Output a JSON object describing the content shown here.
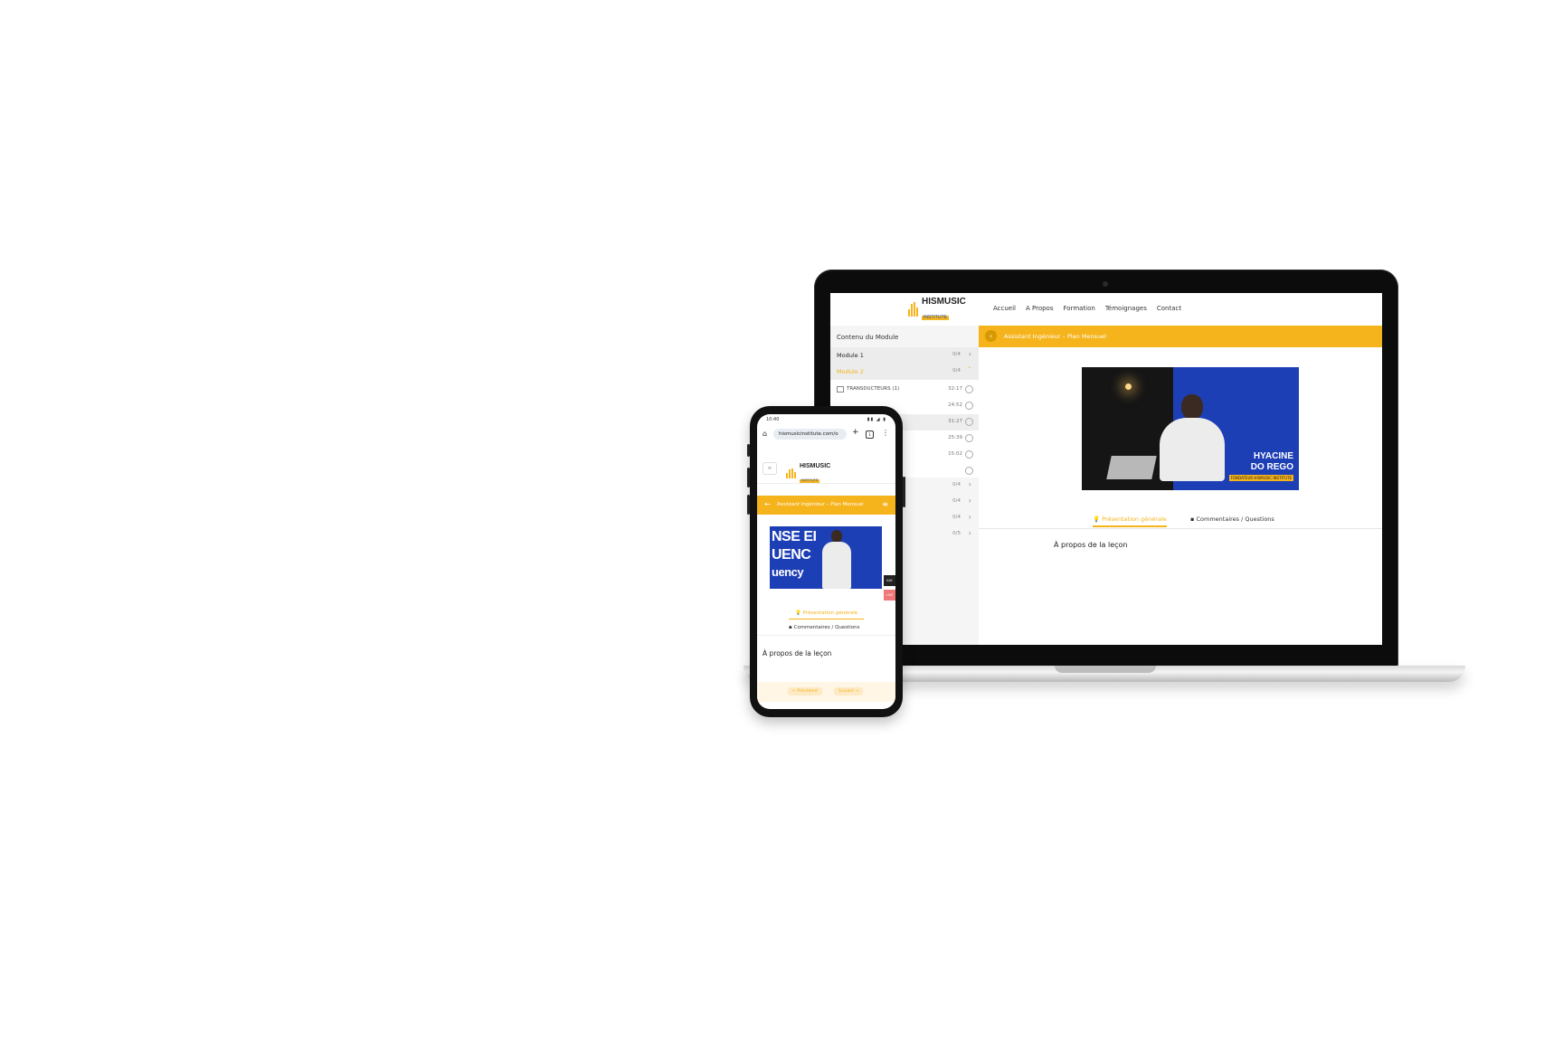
{
  "brand": {
    "name": "HISMUSIC",
    "sub": "INSTITUTE",
    "accent": "#f5b31c",
    "blue": "#1d3fb5"
  },
  "laptop": {
    "nav": [
      "Accueil",
      "A Propos",
      "Formation",
      "Témoignages",
      "Contact"
    ],
    "sidebar": {
      "title": "Contenu du Module",
      "modules": [
        {
          "label": "Module 1",
          "count": "0/4"
        },
        {
          "label": "Module 2",
          "count": "0/4"
        }
      ],
      "lessons": [
        {
          "title": "TRANSDUCTEURS (1)",
          "time": "32:17"
        },
        {
          "title": "",
          "time": "24:52"
        },
        {
          "title": "",
          "time": "31:27"
        },
        {
          "title": "",
          "time": "25:39"
        },
        {
          "title": "",
          "time": "15:02"
        },
        {
          "title": "",
          "time": ""
        }
      ],
      "more_modules": [
        {
          "label": "",
          "count": "0/4"
        },
        {
          "label": "",
          "count": "0/4"
        },
        {
          "label": "",
          "count": "0/4"
        },
        {
          "label": "",
          "count": "0/5"
        }
      ]
    },
    "bar_title": "Assistant Ingénieur – Plan Mensuel",
    "video": {
      "name_line1": "HYACINE",
      "name_line2": "DO REGO",
      "role": "FONDATEUR HISMUSIC INSTITUTE"
    },
    "tabs": {
      "overview": "Présentation générale",
      "comments": "Commentaires / Questions"
    },
    "about": "À propos de la leçon"
  },
  "phone": {
    "status_time": "10:40",
    "status_icons": "▮▮ ◢ ▮",
    "url": "hismusicinstitute.com/o",
    "tab_count": "1",
    "menu_label": "≡",
    "bar_title": "Assistant Ingénieur – Plan Mensuel",
    "video_lines": [
      "NSE EI",
      "UENC",
      "uency"
    ],
    "side_a": "KAY",
    "side_b": "LIVE",
    "tabs": {
      "overview": "Présentation générale",
      "comments": "Commentaires / Questions"
    },
    "about": "À propos de la leçon",
    "prev": "← Précédent",
    "next": "Suivant →"
  }
}
